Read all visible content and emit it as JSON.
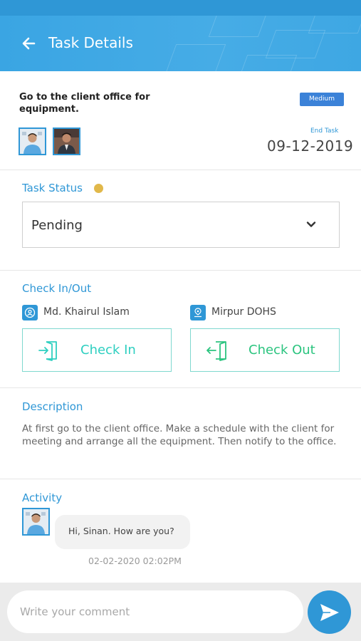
{
  "header": {
    "title": "Task Details",
    "back_icon": "arrow-left-icon",
    "color": "#3aa5e3"
  },
  "task": {
    "title": "Go to the client office for equipment.",
    "priority": "Medium",
    "end_label": "End Task",
    "end_date": "09-12-2019"
  },
  "status_section": {
    "title": "Task Status",
    "selected": "Pending",
    "dot_color": "#e1b84a"
  },
  "check_section": {
    "title": "Check In/Out",
    "person_name": "Md. Khairul Islam",
    "location": "Mirpur DOHS",
    "check_in_label": "Check In",
    "check_out_label": "Check Out"
  },
  "description_section": {
    "title": "Description",
    "text": "At first go to the client office. Make a schedule with the client for meeting and arrange all the equipment. Then notify to the office."
  },
  "activity_section": {
    "title": "Activity",
    "message": "Hi, Sinan. How are you?",
    "timestamp": "02-02-2020 02:02PM"
  },
  "comment": {
    "placeholder": "Write your comment",
    "value": ""
  },
  "colors": {
    "accent": "#2f97d6",
    "check_in": "#2ecfc0",
    "check_out": "#2bc47f"
  }
}
